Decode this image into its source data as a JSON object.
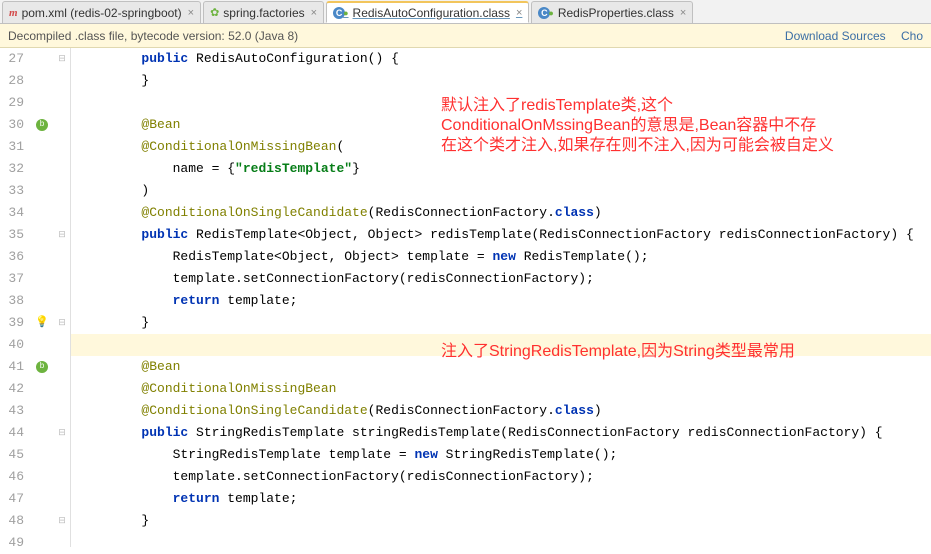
{
  "tabs": [
    {
      "label": "pom.xml (redis-02-springboot)"
    },
    {
      "label": "spring.factories"
    },
    {
      "label": "RedisAutoConfiguration.class"
    },
    {
      "label": "RedisProperties.class"
    }
  ],
  "info": {
    "text": "Decompiled .class file, bytecode version: 52.0 (Java 8)",
    "link_download": "Download Sources",
    "link_choose": "Cho"
  },
  "overlays": {
    "ov1_l1": "默认注入了redisTemplate类,这个",
    "ov1_l2": "ConditionalOnMssingBean的意思是,Bean容器中不存",
    "ov1_l3": "在这个类才注入,如果存在则不注入,因为可能会被自定义",
    "ov2": "注入了StringRedisTemplate,因为String类型最常用"
  },
  "lines": {
    "start": 27,
    "rows": [
      {
        "indent": 2,
        "tokens": [
          {
            "c": "kw",
            "t": "public"
          },
          {
            "c": "",
            "t": " RedisAutoConfiguration() {"
          }
        ]
      },
      {
        "indent": 2,
        "tokens": [
          {
            "c": "",
            "t": "}"
          }
        ]
      },
      {
        "indent": 0,
        "tokens": []
      },
      {
        "indent": 2,
        "tokens": [
          {
            "c": "ann",
            "t": "@Bean"
          }
        ]
      },
      {
        "indent": 2,
        "tokens": [
          {
            "c": "ann",
            "t": "@ConditionalOnMissingBean"
          },
          {
            "c": "",
            "t": "("
          }
        ]
      },
      {
        "indent": 3,
        "tokens": [
          {
            "c": "",
            "t": "name = {"
          },
          {
            "c": "str",
            "t": "\"redisTemplate\""
          },
          {
            "c": "",
            "t": "}"
          }
        ]
      },
      {
        "indent": 2,
        "tokens": [
          {
            "c": "",
            "t": ")"
          }
        ]
      },
      {
        "indent": 2,
        "tokens": [
          {
            "c": "ann",
            "t": "@ConditionalOnSingleCandidate"
          },
          {
            "c": "",
            "t": "(RedisConnectionFactory."
          },
          {
            "c": "kw",
            "t": "class"
          },
          {
            "c": "",
            "t": ")"
          }
        ]
      },
      {
        "indent": 2,
        "tokens": [
          {
            "c": "kw",
            "t": "public"
          },
          {
            "c": "",
            "t": " RedisTemplate<Object, Object> redisTemplate(RedisConnectionFactory redisConnectionFactory) {"
          }
        ]
      },
      {
        "indent": 3,
        "tokens": [
          {
            "c": "",
            "t": "RedisTemplate<Object, Object> template = "
          },
          {
            "c": "kw",
            "t": "new"
          },
          {
            "c": "",
            "t": " RedisTemplate();"
          }
        ]
      },
      {
        "indent": 3,
        "tokens": [
          {
            "c": "",
            "t": "template.setConnectionFactory(redisConnectionFactory);"
          }
        ]
      },
      {
        "indent": 3,
        "tokens": [
          {
            "c": "kw",
            "t": "return"
          },
          {
            "c": "",
            "t": " template;"
          }
        ]
      },
      {
        "indent": 2,
        "tokens": [
          {
            "c": "",
            "t": "}"
          }
        ]
      },
      {
        "indent": 0,
        "tokens": [],
        "hl": true
      },
      {
        "indent": 2,
        "tokens": [
          {
            "c": "ann",
            "t": "@Bean"
          }
        ]
      },
      {
        "indent": 2,
        "tokens": [
          {
            "c": "ann",
            "t": "@ConditionalOnMissingBean"
          }
        ]
      },
      {
        "indent": 2,
        "tokens": [
          {
            "c": "ann",
            "t": "@ConditionalOnSingleCandidate"
          },
          {
            "c": "",
            "t": "(RedisConnectionFactory."
          },
          {
            "c": "kw",
            "t": "class"
          },
          {
            "c": "",
            "t": ")"
          }
        ]
      },
      {
        "indent": 2,
        "tokens": [
          {
            "c": "kw",
            "t": "public"
          },
          {
            "c": "",
            "t": " StringRedisTemplate stringRedisTemplate(RedisConnectionFactory redisConnectionFactory) {"
          }
        ]
      },
      {
        "indent": 3,
        "tokens": [
          {
            "c": "",
            "t": "StringRedisTemplate template = "
          },
          {
            "c": "kw",
            "t": "new"
          },
          {
            "c": "",
            "t": " StringRedisTemplate();"
          }
        ]
      },
      {
        "indent": 3,
        "tokens": [
          {
            "c": "",
            "t": "template.setConnectionFactory(redisConnectionFactory);"
          }
        ]
      },
      {
        "indent": 3,
        "tokens": [
          {
            "c": "kw",
            "t": "return"
          },
          {
            "c": "",
            "t": " template;"
          }
        ]
      },
      {
        "indent": 2,
        "tokens": [
          {
            "c": "",
            "t": "}"
          }
        ]
      },
      {
        "indent": 0,
        "tokens": []
      }
    ],
    "markers": {
      "30": "green",
      "39": "bulb",
      "41": "green"
    },
    "folds": {
      "27": "-",
      "35": "-",
      "39": "-",
      "44": "-",
      "48": "-"
    }
  }
}
